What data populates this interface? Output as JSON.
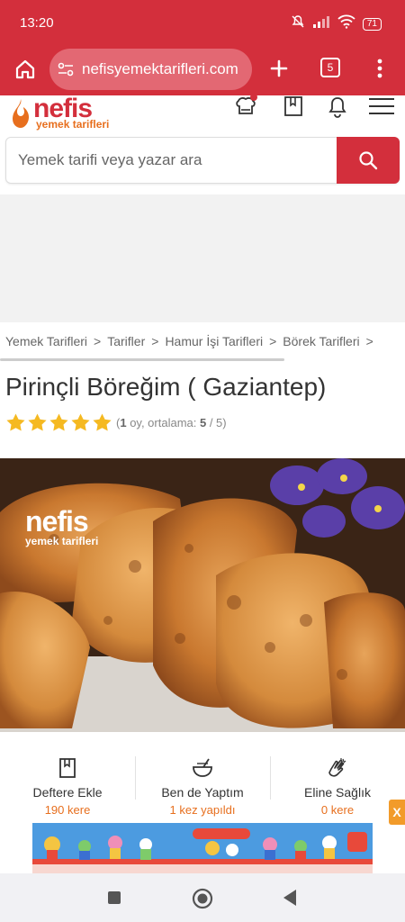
{
  "status": {
    "time": "13:20",
    "battery": "71"
  },
  "browser": {
    "url": "nefisyemektarifleri.com",
    "tab_count": "5"
  },
  "site": {
    "logo_name": "nefis",
    "logo_sub": "yemek tarifleri"
  },
  "search": {
    "placeholder": "Yemek tarifi veya yazar ara"
  },
  "breadcrumb": {
    "items": [
      "Yemek Tarifleri",
      "Tarifler",
      "Hamur İşi Tarifleri",
      "Börek Tarifleri"
    ],
    "separator": ">"
  },
  "recipe": {
    "title": "Pirinçli Böreğim ( Gaziantep)",
    "rating": {
      "stars": 5,
      "open": "(",
      "votes": "1",
      "votes_text": " oy, ortalama: ",
      "average": "5",
      "max_text": " / 5)"
    },
    "watermark_name": "nefis",
    "watermark_sub": "yemek tarifleri"
  },
  "actions": [
    {
      "label": "Deftere Ekle",
      "count": "190 kere"
    },
    {
      "label": "Ben de Yaptım",
      "count": "1 kez yapıldı"
    },
    {
      "label": "Eline Sağlık",
      "count": "0 kere"
    }
  ],
  "ad": {
    "close_label": "X"
  },
  "colors": {
    "brand_red": "#d32f3c",
    "accent_orange": "#e76f1e",
    "star": "#f5b921"
  }
}
